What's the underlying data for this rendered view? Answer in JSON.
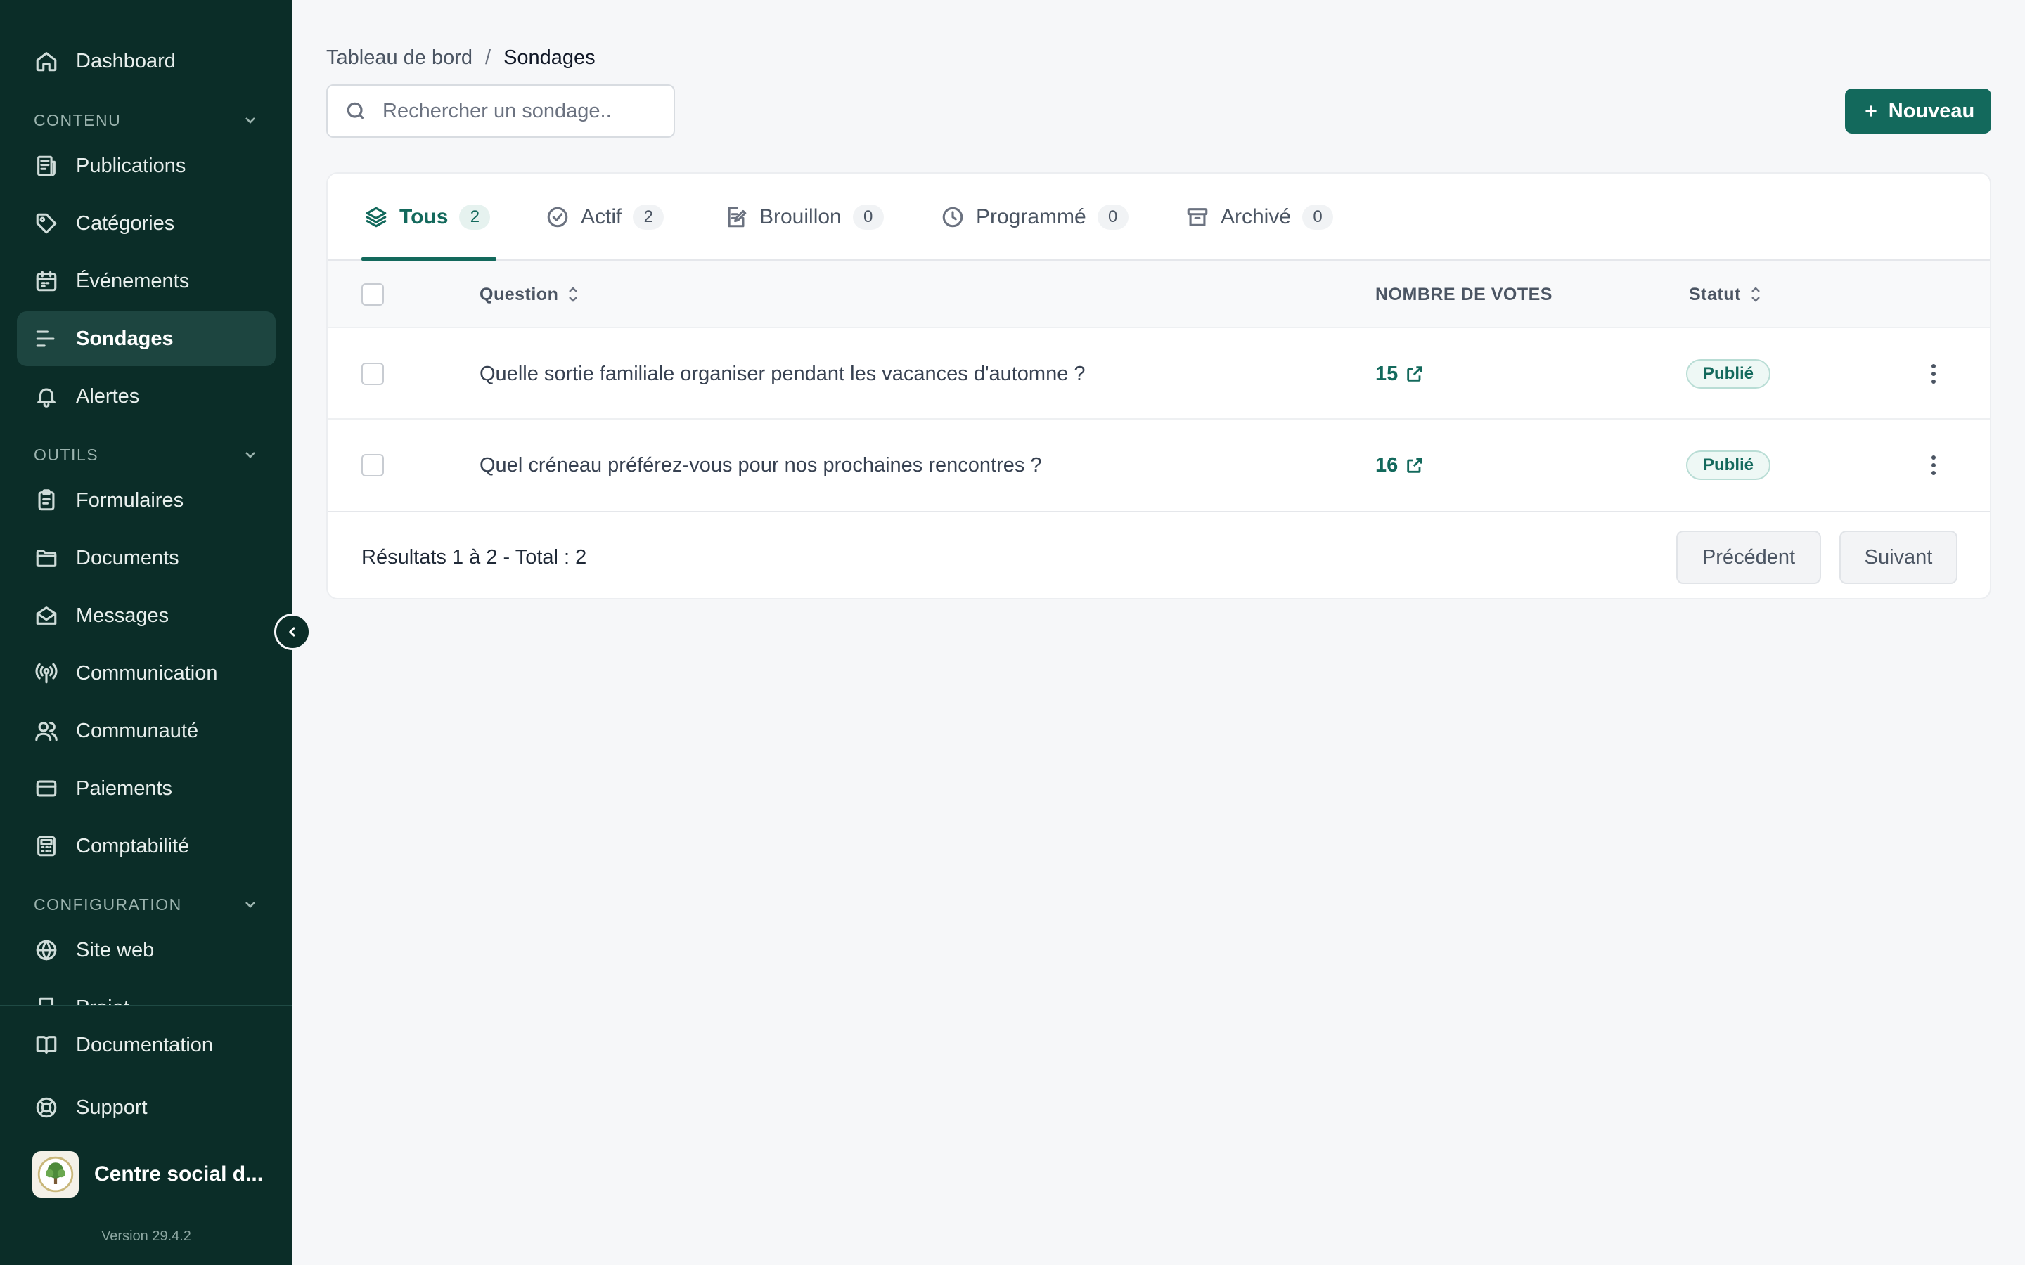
{
  "sidebar": {
    "top_item": {
      "label": "Dashboard",
      "icon": "home-icon"
    },
    "sections": [
      {
        "title": "CONTENU",
        "items": [
          {
            "label": "Publications",
            "icon": "newspaper-icon"
          },
          {
            "label": "Catégories",
            "icon": "tag-icon"
          },
          {
            "label": "Événements",
            "icon": "calendar-icon"
          },
          {
            "label": "Sondages",
            "icon": "poll-icon",
            "active": true
          },
          {
            "label": "Alertes",
            "icon": "bell-icon"
          }
        ]
      },
      {
        "title": "OUTILS",
        "items": [
          {
            "label": "Formulaires",
            "icon": "clipboard-icon"
          },
          {
            "label": "Documents",
            "icon": "folder-icon"
          },
          {
            "label": "Messages",
            "icon": "envelope-icon"
          },
          {
            "label": "Communication",
            "icon": "broadcast-icon"
          },
          {
            "label": "Communauté",
            "icon": "users-icon"
          },
          {
            "label": "Paiements",
            "icon": "credit-card-icon"
          },
          {
            "label": "Comptabilité",
            "icon": "calculator-icon"
          }
        ]
      },
      {
        "title": "CONFIGURATION",
        "items": [
          {
            "label": "Site web",
            "icon": "globe-icon"
          },
          {
            "label": "Projet",
            "icon": "bookmark-icon"
          }
        ]
      }
    ],
    "bottom_items": [
      {
        "label": "Documentation",
        "icon": "book-icon"
      },
      {
        "label": "Support",
        "icon": "lifebuoy-icon"
      }
    ],
    "organization": "Centre social d...",
    "version": "Version 29.4.2"
  },
  "breadcrumb": {
    "parent": "Tableau de bord",
    "separator": "/",
    "current": "Sondages"
  },
  "search": {
    "placeholder": "Rechercher un sondage.."
  },
  "new_button": {
    "label": "Nouveau"
  },
  "tabs": [
    {
      "label": "Tous",
      "count": "2",
      "icon": "layers-icon",
      "active": true
    },
    {
      "label": "Actif",
      "count": "2",
      "icon": "check-circle-icon"
    },
    {
      "label": "Brouillon",
      "count": "0",
      "icon": "edit-document-icon"
    },
    {
      "label": "Programmé",
      "count": "0",
      "icon": "clock-icon"
    },
    {
      "label": "Archivé",
      "count": "0",
      "icon": "archive-icon"
    }
  ],
  "table": {
    "columns": {
      "question": "Question",
      "votes": "NOMBRE DE VOTES",
      "status": "Statut"
    },
    "rows": [
      {
        "question": "Quelle sortie familiale organiser pendant les vacances d'automne ?",
        "votes": "15",
        "status": "Publié"
      },
      {
        "question": "Quel créneau préférez-vous pour nos prochaines rencontres ?",
        "votes": "16",
        "status": "Publié"
      }
    ]
  },
  "pagination": {
    "summary": "Résultats 1 à 2 - Total : 2",
    "previous": "Précédent",
    "next": "Suivant"
  },
  "colors": {
    "sidebar_bg": "#0b2d28",
    "accent": "#13695c",
    "page_bg": "#f6f7f9"
  }
}
